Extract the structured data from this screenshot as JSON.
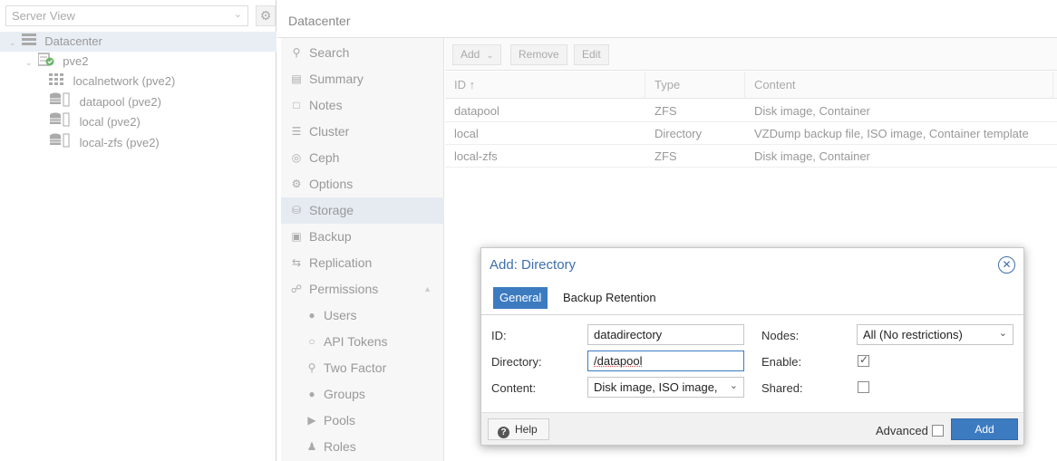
{
  "left_panel": {
    "view_selector": "Server View",
    "tree": [
      {
        "label": "Datacenter",
        "icon": "datacenter-icon"
      },
      {
        "label": "pve2",
        "icon": "node-online-icon"
      },
      {
        "label": "localnetwork (pve2)",
        "icon": "network-icon"
      },
      {
        "label": "datapool (pve2)",
        "icon": "storage-icon"
      },
      {
        "label": "local (pve2)",
        "icon": "storage-icon"
      },
      {
        "label": "local-zfs (pve2)",
        "icon": "storage-icon"
      }
    ]
  },
  "header": {
    "title": "Datacenter"
  },
  "menu": {
    "items": [
      {
        "label": "Search",
        "icon": "search-icon"
      },
      {
        "label": "Summary",
        "icon": "book-icon"
      },
      {
        "label": "Notes",
        "icon": "note-icon"
      },
      {
        "label": "Cluster",
        "icon": "server-icon"
      },
      {
        "label": "Ceph",
        "icon": "ceph-icon"
      },
      {
        "label": "Options",
        "icon": "gear-icon"
      },
      {
        "label": "Storage",
        "icon": "database-icon"
      },
      {
        "label": "Backup",
        "icon": "floppy-icon"
      },
      {
        "label": "Replication",
        "icon": "retweet-icon"
      },
      {
        "label": "Permissions",
        "icon": "unlock-icon"
      },
      {
        "label": "Users",
        "icon": "user-icon"
      },
      {
        "label": "API Tokens",
        "icon": "user-outline-icon"
      },
      {
        "label": "Two Factor",
        "icon": "key-icon"
      },
      {
        "label": "Groups",
        "icon": "users-icon"
      },
      {
        "label": "Pools",
        "icon": "tags-icon"
      },
      {
        "label": "Roles",
        "icon": "male-icon"
      }
    ]
  },
  "toolbar": {
    "add": "Add",
    "remove": "Remove",
    "edit": "Edit"
  },
  "grid": {
    "columns": [
      "ID ↑",
      "Type",
      "Content"
    ],
    "rows": [
      {
        "id": "datapool",
        "type": "ZFS",
        "content": "Disk image, Container"
      },
      {
        "id": "local",
        "type": "Directory",
        "content": "VZDump backup file, ISO image, Container template"
      },
      {
        "id": "local-zfs",
        "type": "ZFS",
        "content": "Disk image, Container"
      }
    ]
  },
  "dialog": {
    "title": "Add: Directory",
    "tabs": [
      "General",
      "Backup Retention"
    ],
    "fields": {
      "id_label": "ID:",
      "id_value": "datadirectory",
      "directory_label": "Directory:",
      "directory_value": "/datapool",
      "content_label": "Content:",
      "content_value": "Disk image, ISO image,",
      "nodes_label": "Nodes:",
      "nodes_value": "All (No restrictions)",
      "enable_label": "Enable:",
      "enable_checked": true,
      "shared_label": "Shared:",
      "shared_checked": false
    },
    "footer": {
      "help": "Help",
      "advanced": "Advanced",
      "advanced_checked": false,
      "add": "Add"
    }
  },
  "colors": {
    "accent": "#3d7bc1",
    "title": "#3c6fae"
  }
}
